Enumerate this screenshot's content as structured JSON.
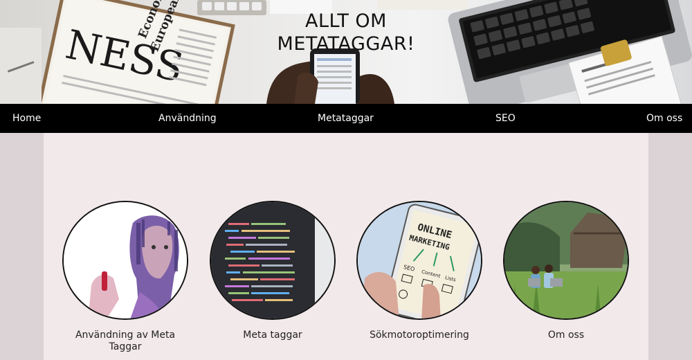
{
  "hero": {
    "title_line1": "ALLT OM",
    "title_line2": "METATAGGAR!",
    "newspaper_headline": "NESS",
    "newspaper_subline1": "Economy of the",
    "newspaper_subline2": "European Union"
  },
  "nav": {
    "items": [
      {
        "label": "Home"
      },
      {
        "label": "Användning"
      },
      {
        "label": "Metataggar"
      },
      {
        "label": "SEO"
      },
      {
        "label": "Om oss"
      }
    ]
  },
  "cards": [
    {
      "label": "Användning av Meta Taggar",
      "icon": "ai-robot-face-image"
    },
    {
      "label": "Meta taggar",
      "icon": "code-screen-image"
    },
    {
      "label": "Sökmotoroptimering",
      "icon": "online-marketing-tablet-image",
      "tablet_line1": "ONLINE",
      "tablet_line2": "MARKETING",
      "tablet_seo": "SEO",
      "tablet_content": "Content",
      "tablet_lists": "Lists"
    },
    {
      "label": "Om oss",
      "icon": "kids-laptops-field-image"
    }
  ],
  "colors": {
    "nav_bg": "#000000",
    "nav_text": "#ffffff",
    "content_bg": "#f2e9ea",
    "page_bg": "#dcd3d6"
  }
}
